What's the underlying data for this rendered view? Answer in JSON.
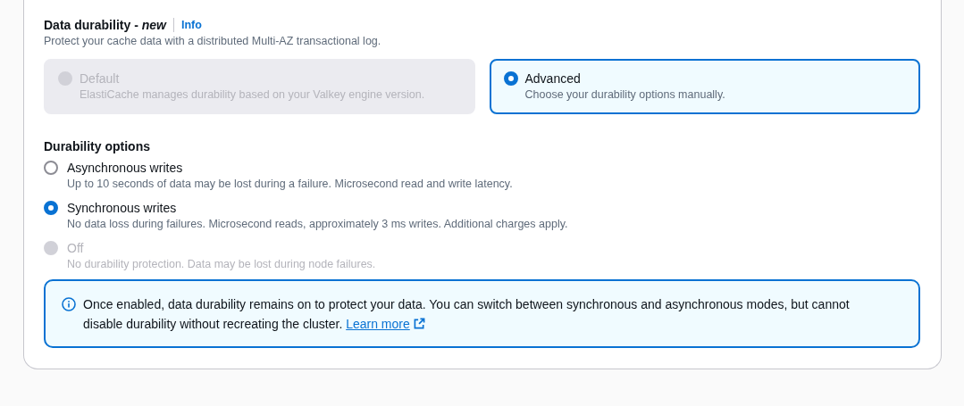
{
  "section": {
    "title": "Data durability - *new*",
    "info_link": "Info",
    "description": "Protect your cache data with a distributed Multi-AZ transactional log."
  },
  "modes": [
    {
      "label": "Default",
      "description": "ElastiCache manages durability based on your Valkey engine version.",
      "selected": false,
      "disabled": true
    },
    {
      "label": "Advanced",
      "description": "Choose your durability options manually.",
      "selected": true,
      "disabled": false
    }
  ],
  "durability_options": {
    "title": "Durability options",
    "options": [
      {
        "label": "Asynchronous writes",
        "description": "Up to 10 seconds of data may be lost during a failure. Microsecond read and write latency.",
        "selected": false,
        "disabled": false
      },
      {
        "label": "Synchronous writes",
        "description": "No data loss during failures. Microsecond reads, approximately 3 ms writes. Additional charges apply.",
        "selected": true,
        "disabled": false
      },
      {
        "label": "Off",
        "description": "No durability protection. Data may be lost during node failures.",
        "selected": false,
        "disabled": true
      }
    ]
  },
  "alert": {
    "text": "Once enabled, data durability remains on to protect your data. You can switch between synchronous and asynchronous modes, but cannot disable durability without recreating the cluster.",
    "link": "Learn more"
  }
}
